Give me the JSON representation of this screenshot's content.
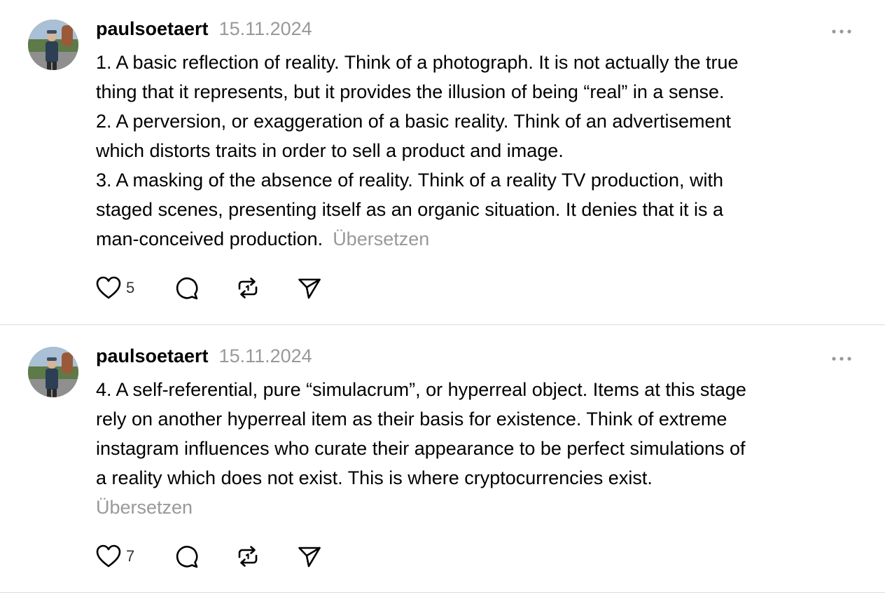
{
  "posts": [
    {
      "username": "paulsoetaert",
      "date": "15.11.2024",
      "lines": [
        "1. A basic reflection of reality. Think of a photograph. It is not actually the true",
        "thing that it represents, but it provides the illusion of being “real” in a sense.",
        "2. A perversion, or exaggeration of a basic reality. Think of an advertisement",
        "which distorts traits in order to sell a product and image.",
        "3. A masking of the absence of reality. Think of a reality TV production, with",
        "staged scenes, presenting itself as an organic situation. It denies that it is a",
        "man-conceived production."
      ],
      "translate_label": "Übersetzen",
      "likes": "5",
      "icons": {
        "like": "heart-icon",
        "reply": "speech-bubble-icon",
        "repost": "repost-arrows-icon",
        "share": "paper-plane-icon",
        "more": "ellipsis-icon"
      }
    },
    {
      "username": "paulsoetaert",
      "date": "15.11.2024",
      "lines": [
        "4. A self-referential, pure “simulacrum”, or hyperreal object. Items at this stage",
        "rely on another hyperreal item as their basis for existence. Think of extreme",
        "instagram influences who curate their appearance to be perfect simulations of",
        "a reality which does not exist. This is where cryptocurrencies exist."
      ],
      "translate_label": "Übersetzen",
      "likes": "7",
      "icons": {
        "like": "heart-icon",
        "reply": "speech-bubble-icon",
        "repost": "repost-arrows-icon",
        "share": "paper-plane-icon",
        "more": "ellipsis-icon"
      }
    }
  ],
  "colors": {
    "text": "#000000",
    "secondary_text": "#999999",
    "divider": "#dcdcdc",
    "icon": "#000000"
  }
}
